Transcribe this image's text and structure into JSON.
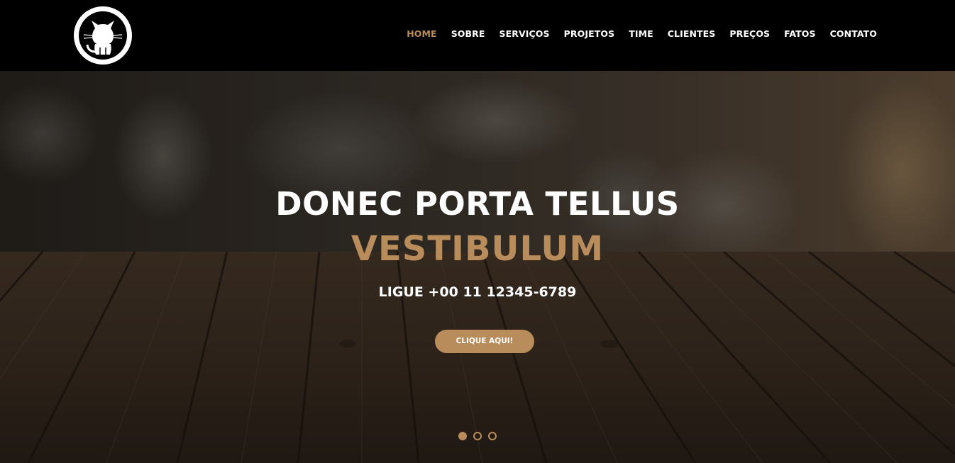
{
  "navbar": {
    "logo": {
      "icon": "github-octocat-icon"
    },
    "items": [
      {
        "label": "HOME",
        "active": true
      },
      {
        "label": "SOBRE",
        "active": false
      },
      {
        "label": "SERVIÇOS",
        "active": false
      },
      {
        "label": "PROJETOS",
        "active": false
      },
      {
        "label": "TIME",
        "active": false
      },
      {
        "label": "CLIENTES",
        "active": false
      },
      {
        "label": "PREÇOS",
        "active": false
      },
      {
        "label": "FATOS",
        "active": false
      },
      {
        "label": "CONTATO",
        "active": false
      }
    ]
  },
  "hero": {
    "title_line1": "DONEC PORTA TELLUS",
    "title_line2": "VESTIBULUM",
    "phone": "LIGUE +00 11 12345-6789",
    "cta_label": "CLIQUE AQUI!",
    "slides": {
      "count": 3,
      "active": 1
    }
  },
  "colors": {
    "accent": "#b98c5c",
    "navbar_bg": "#000000",
    "text": "#ffffff"
  }
}
